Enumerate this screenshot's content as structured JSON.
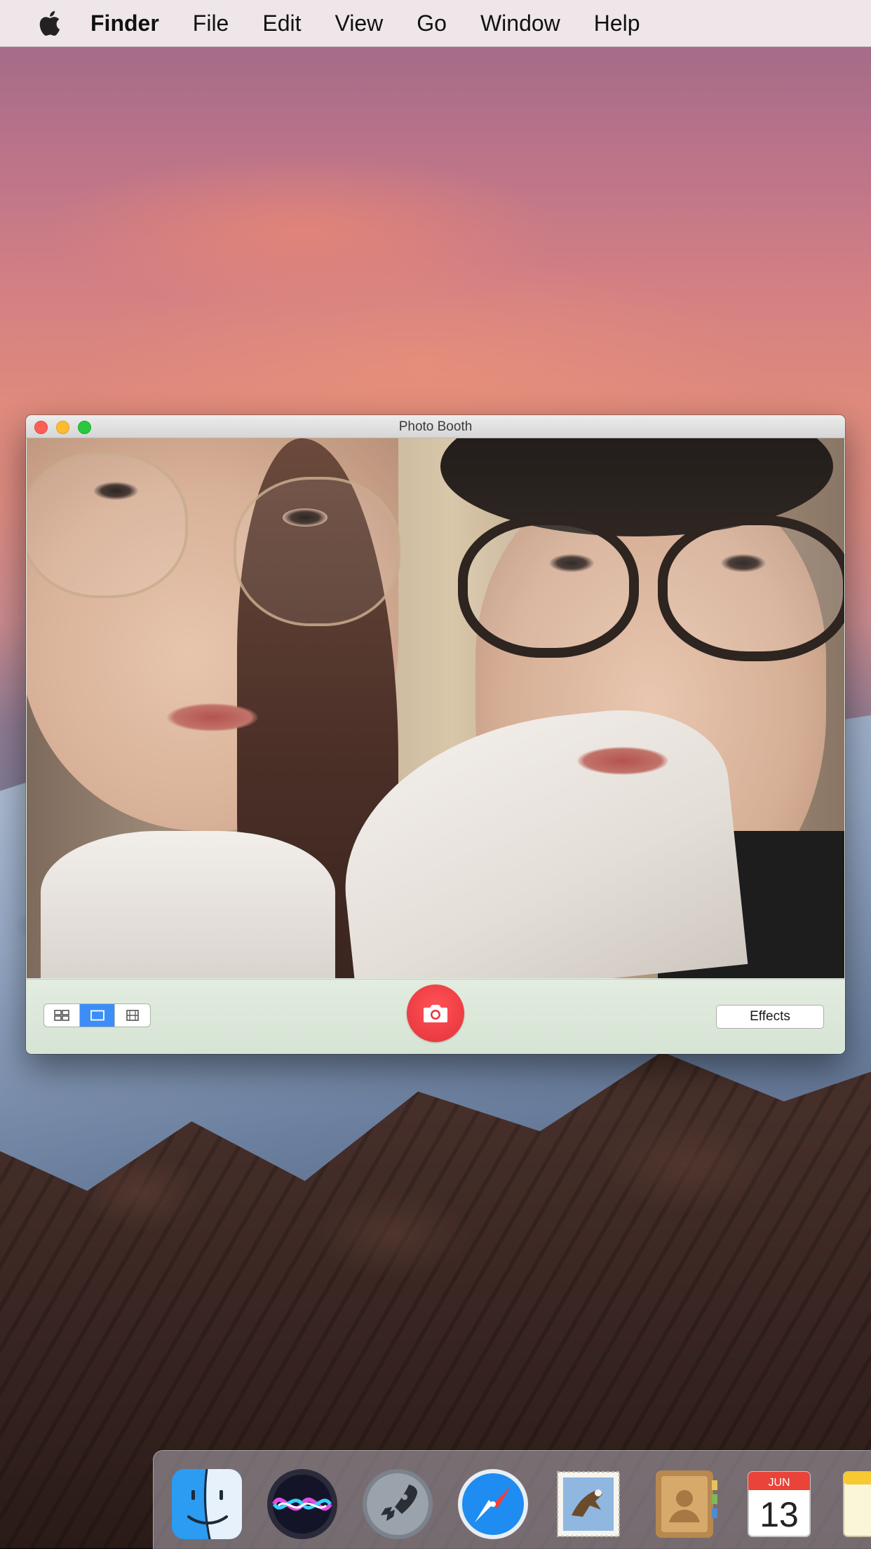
{
  "menubar": {
    "apple_icon": "apple-logo-icon",
    "app_name": "Finder",
    "items": [
      "File",
      "Edit",
      "View",
      "Go",
      "Window",
      "Help"
    ]
  },
  "window": {
    "title": "Photo Booth",
    "effects_label": "Effects",
    "layout_modes": [
      "four-up-grid-icon",
      "single-photo-icon",
      "filmstrip-icon"
    ],
    "active_layout": "single-photo-icon",
    "shutter_icon": "camera-icon"
  },
  "dock": {
    "apps": [
      "Finder",
      "Siri",
      "Launchpad",
      "Safari",
      "Mail",
      "Contacts",
      "Calendar",
      "Notes"
    ],
    "calendar": {
      "month": "JUN",
      "day": "13"
    }
  },
  "colors": {
    "shutter": "#e8363d",
    "active_segment": "#3c8ef6",
    "toolbar": "#dbe7d8"
  }
}
